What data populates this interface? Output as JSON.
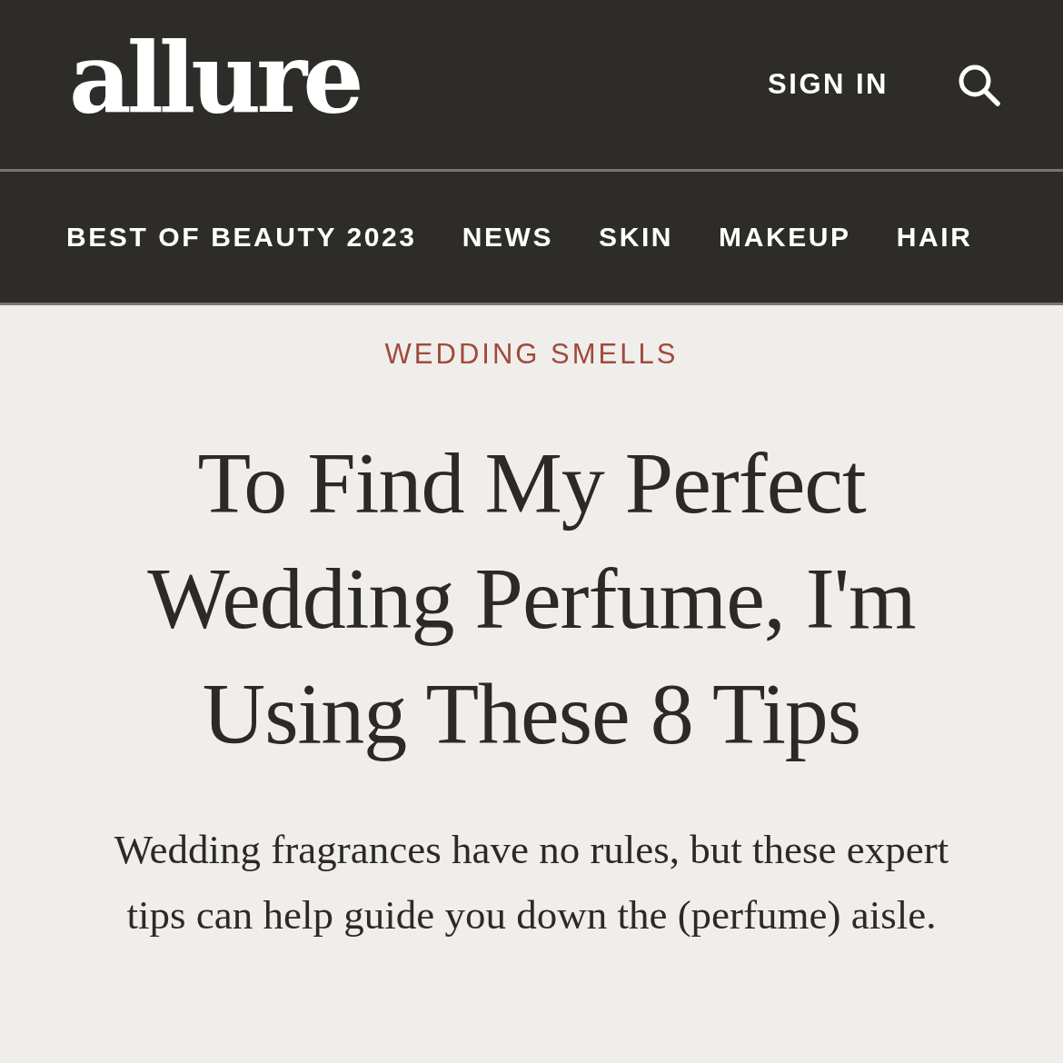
{
  "header": {
    "logo": "allure",
    "sign_in": "SIGN IN"
  },
  "nav": {
    "items": [
      {
        "label": "BEST OF BEAUTY 2023"
      },
      {
        "label": "NEWS"
      },
      {
        "label": "SKIN"
      },
      {
        "label": "MAKEUP"
      },
      {
        "label": "HAIR"
      }
    ]
  },
  "article": {
    "kicker": "WEDDING SMELLS",
    "headline": "To Find My Perfect Wedding Perfume, I'm Using These 8 Tips",
    "dek": "Wedding fragrances have no rules, but these expert tips can help guide you down the (perfume) aisle."
  }
}
